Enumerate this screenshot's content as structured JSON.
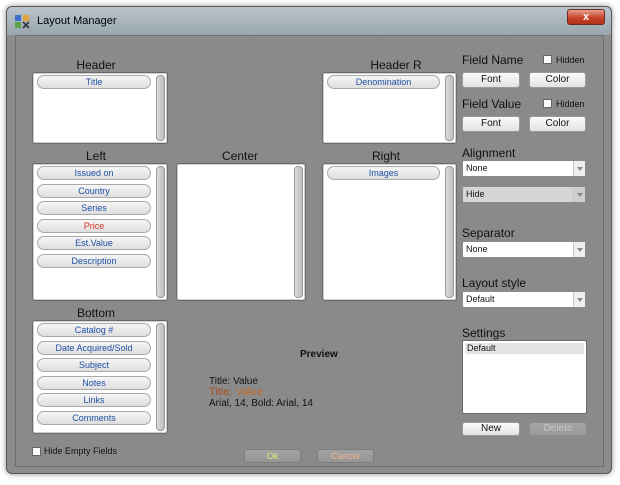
{
  "window": {
    "title": "Layout Manager",
    "close_symbol": "x"
  },
  "sections": {
    "header": {
      "label": "Header",
      "items": [
        "Title"
      ]
    },
    "header_r": {
      "label": "Header R",
      "items": [
        "Denomination"
      ]
    },
    "left": {
      "label": "Left",
      "items": [
        "Issued on",
        "Country",
        "Series",
        "Price",
        "Est.Value",
        "Description"
      ]
    },
    "center": {
      "label": "Center",
      "items": []
    },
    "right": {
      "label": "Right",
      "items": [
        "Images"
      ]
    },
    "bottom": {
      "label": "Bottom",
      "items": [
        "Catalog #",
        "Date Acquired/Sold",
        "Subject",
        "Notes",
        "Links",
        "Comments"
      ]
    }
  },
  "field_name": {
    "label": "Field Name",
    "hidden_label": "Hidden",
    "font_btn": "Font",
    "color_btn": "Color"
  },
  "field_value": {
    "label": "Field Value",
    "hidden_label": "Hidden",
    "font_btn": "Font",
    "color_btn": "Color"
  },
  "alignment": {
    "label": "Alignment",
    "value": "None",
    "second_value": "Hide"
  },
  "separator": {
    "label": "Separator",
    "value": "None"
  },
  "layout_style": {
    "label": "Layout style",
    "value": "Default"
  },
  "settings": {
    "label": "Settings",
    "items": [
      "Default"
    ],
    "new_btn": "New",
    "delete_btn": "Delete"
  },
  "preview": {
    "title": "Preview",
    "line1": "Title: Value",
    "line2_name": "Title:",
    "line2_value": "Value",
    "line3": "Arial, 14, Bold: Arial, 14"
  },
  "hide_empty_label": "Hide Empty Fields",
  "buttons": {
    "ok": "Ok",
    "cancel": "Cancel"
  },
  "colors": {
    "window_bg": "#8a8a8a",
    "link_blue": "#1f4fa3",
    "highlight_red": "#d8322a",
    "preview_orange": "#a4531b",
    "ok_text": "#dcec7a",
    "cancel_text": "#f0b48a"
  }
}
